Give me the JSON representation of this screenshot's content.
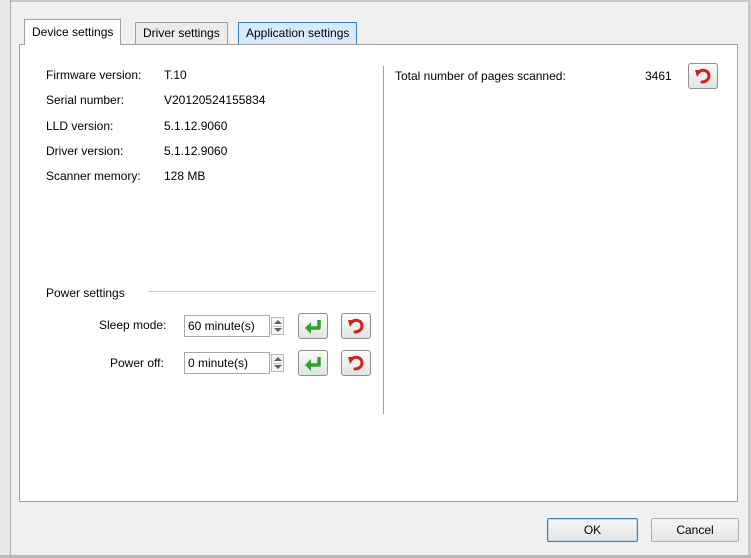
{
  "tabs": [
    {
      "label": "Device settings",
      "state": "selected"
    },
    {
      "label": "Driver settings",
      "state": "normal"
    },
    {
      "label": "Application settings",
      "state": "hover"
    }
  ],
  "device_info": {
    "firmware_label": "Firmware version:",
    "firmware_value": "T.10",
    "serial_label": "Serial number:",
    "serial_value": "V20120524155834",
    "lld_label": "LLD version:",
    "lld_value": "5.1.12.9060",
    "driver_label": "Driver version:",
    "driver_value": "5.1.12.9060",
    "memory_label": "Scanner memory:",
    "memory_value": "128 MB"
  },
  "pages_scanned": {
    "label": "Total number of pages scanned:",
    "value": "3461",
    "reset_icon": "undo-arrow-icon"
  },
  "power_settings": {
    "group_label": "Power settings",
    "sleep_label": "Sleep mode:",
    "sleep_value": "60 minute(s)",
    "poweroff_label": "Power off:",
    "poweroff_value": "0 minute(s)",
    "apply_icon": "green-enter-arrow-icon",
    "reset_icon": "red-undo-arrow-icon"
  },
  "buttons": {
    "ok": "OK",
    "cancel": "Cancel"
  },
  "colors": {
    "apply_green": "#2ea12e",
    "reset_red": "#d32020",
    "hover_tab_blue": "#d8eaf9"
  }
}
